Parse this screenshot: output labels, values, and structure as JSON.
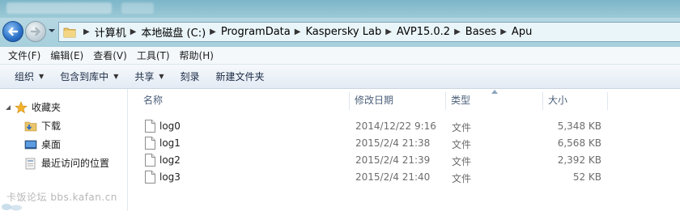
{
  "address": {
    "crumbs": [
      "计算机",
      "本地磁盘 (C:)",
      "ProgramData",
      "Kaspersky Lab",
      "AVP15.0.2",
      "Bases",
      "Apu"
    ]
  },
  "menu": {
    "items": [
      "文件(F)",
      "编辑(E)",
      "查看(V)",
      "工具(T)",
      "帮助(H)"
    ]
  },
  "commands": {
    "organize": "组织",
    "include_in_library": "包含到库中",
    "share": "共享",
    "burn": "刻录",
    "new_folder": "新建文件夹"
  },
  "nav": {
    "favorites": "收藏夹",
    "downloads": "下载",
    "desktop": "桌面",
    "recent": "最近访问的位置"
  },
  "columns": {
    "name": "名称",
    "modified": "修改日期",
    "type": "类型",
    "size": "大小"
  },
  "files": [
    {
      "name": "log0",
      "modified": "2014/12/22 9:16",
      "type": "文件",
      "size": "5,348 KB"
    },
    {
      "name": "log1",
      "modified": "2015/2/4 21:38",
      "type": "文件",
      "size": "6,568 KB"
    },
    {
      "name": "log2",
      "modified": "2015/2/4 21:39",
      "type": "文件",
      "size": "2,392 KB"
    },
    {
      "name": "log3",
      "modified": "2015/2/4 21:40",
      "type": "文件",
      "size": "52 KB"
    }
  ],
  "watermark": "卡饭论坛 bbs.kafan.cn",
  "colors": {
    "nav_bg": "#a6cfdc",
    "address_bg": "#eaf5f9",
    "back_button": "#2a6fc6",
    "command_bar": "#e3ebf4",
    "star": "#f2b22a"
  }
}
